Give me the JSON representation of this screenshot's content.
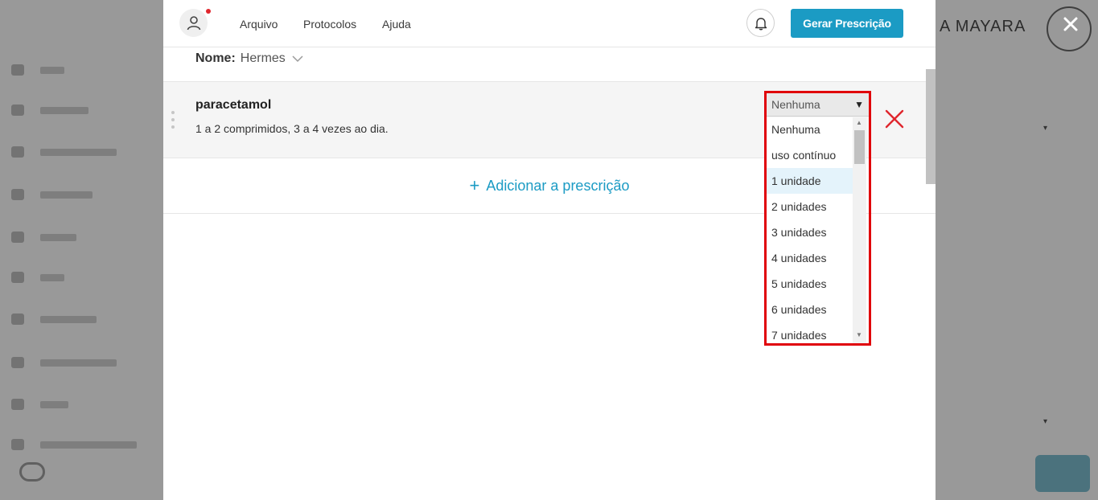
{
  "background": {
    "right_text": "A MAYARA"
  },
  "topbar": {
    "menu": [
      "Arquivo",
      "Protocolos",
      "Ajuda"
    ],
    "generate_button": "Gerar Prescrição"
  },
  "patient": {
    "name_label": "Nome:",
    "name_value": "Hermes"
  },
  "prescription_item": {
    "title": "paracetamol",
    "description": "1 a 2 comprimidos, 3 a 4 vezes ao dia."
  },
  "add_prescription": "Adicionar a prescrição",
  "quantity_select": {
    "selected": "Nenhuma",
    "options": [
      "Nenhuma",
      "uso contínuo",
      "1 unidade",
      "2 unidades",
      "3 unidades",
      "4 unidades",
      "5 unidades",
      "6 unidades",
      "7 unidades"
    ],
    "hovered_index": 2
  },
  "colors": {
    "accent": "#1b9bc4",
    "danger": "#e0262d",
    "highlight": "#e0000a"
  }
}
